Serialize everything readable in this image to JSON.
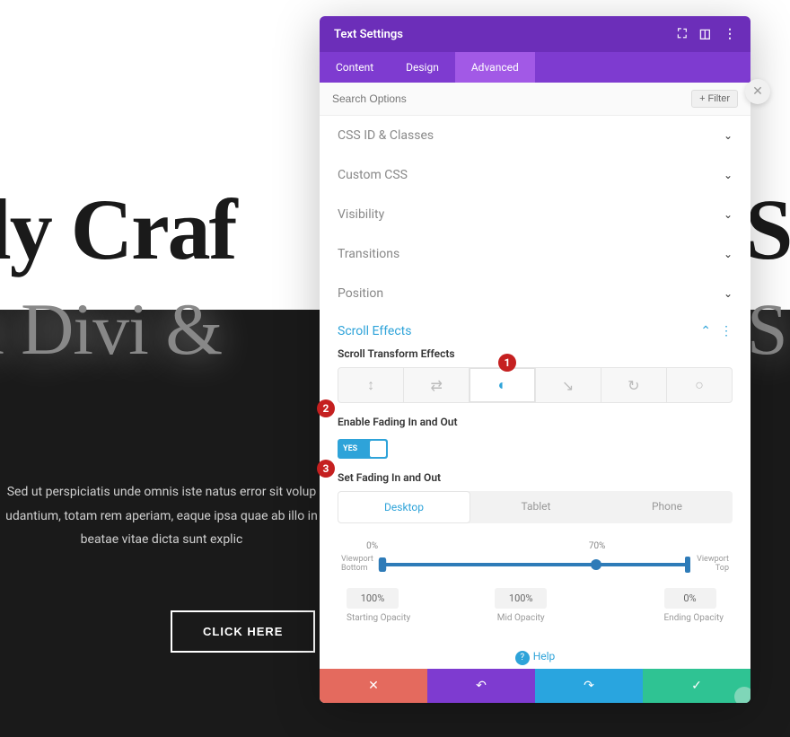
{
  "hero": {
    "title": "ully Craf",
    "subtitle": "vith Divi &",
    "title_tail": "S",
    "subtitle_tail": "S",
    "body": "Sed ut perspiciatis unde omnis iste natus error sit volup udantium, totam rem aperiam, eaque ipsa quae ab illo in beatae vitae dicta sunt explic",
    "cta": "CLICK HERE"
  },
  "panel": {
    "title": "Text Settings",
    "tabs": {
      "content": "Content",
      "design": "Design",
      "advanced": "Advanced"
    },
    "search_placeholder": "Search Options",
    "filter": "+ Filter",
    "sections": {
      "css_id": "CSS ID & Classes",
      "custom_css": "Custom CSS",
      "visibility": "Visibility",
      "transitions": "Transitions",
      "position": "Position",
      "scroll_effects": "Scroll Effects"
    },
    "scroll": {
      "transform_label": "Scroll Transform Effects",
      "enable_label": "Enable Fading In and Out",
      "toggle": "YES",
      "set_label": "Set Fading In and Out",
      "devices": {
        "desktop": "Desktop",
        "tablet": "Tablet",
        "phone": "Phone"
      },
      "viewport_bottom": "Viewport Bottom",
      "viewport_top": "Viewport Top",
      "pct_start": "0%",
      "pct_mid": "70%",
      "opacity_start": {
        "val": "100%",
        "label": "Starting Opacity"
      },
      "opacity_mid": {
        "val": "100%",
        "label": "Mid Opacity"
      },
      "opacity_end": {
        "val": "0%",
        "label": "Ending Opacity"
      }
    },
    "help": "Help"
  },
  "annotations": {
    "a1": "1",
    "a2": "2",
    "a3": "3"
  }
}
